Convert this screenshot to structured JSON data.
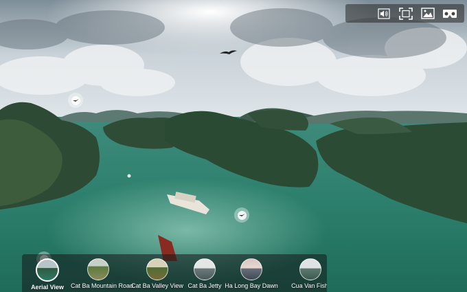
{
  "toolbar": {
    "buttons": [
      {
        "name": "volume-icon",
        "title": "Sound"
      },
      {
        "name": "fullscreen-icon",
        "title": "Fullscreen"
      },
      {
        "name": "gallery-icon",
        "title": "Gallery"
      },
      {
        "name": "vr-icon",
        "title": "VR Mode"
      }
    ]
  },
  "thumbnails": [
    {
      "label": "Aerial View",
      "active": true
    },
    {
      "label": "Cat Ba Mountain Road",
      "active": false
    },
    {
      "label": "Cat Ba Valley View",
      "active": false
    },
    {
      "label": "Cat Ba Jetty",
      "active": false
    },
    {
      "label": "Ha Long Bay Dawn",
      "active": false
    },
    {
      "label": "Cua Van Fishi",
      "active": false
    }
  ],
  "hotspots": [
    {
      "name": "hotspot-birds-left"
    },
    {
      "name": "hotspot-info-bay"
    },
    {
      "name": "hotspot-birds-bottom"
    }
  ]
}
